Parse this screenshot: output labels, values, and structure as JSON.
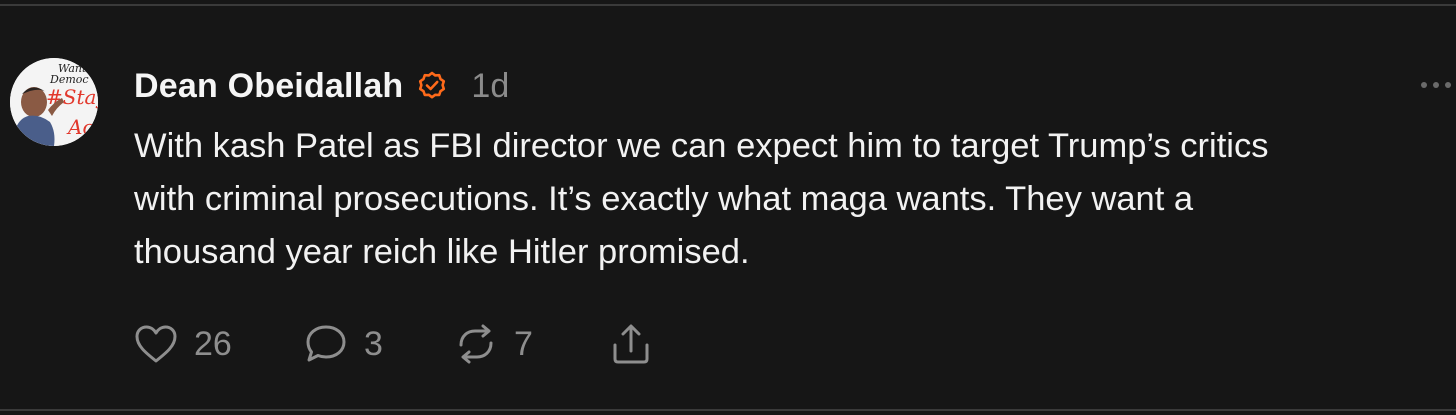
{
  "post": {
    "author": {
      "name": "Dean Obeidallah",
      "avatar_text": [
        "Want",
        "Democ",
        "#Stay",
        "Ac"
      ]
    },
    "verified_icon": "verified-badge-icon",
    "timestamp": "1d",
    "text": "With kash Patel as FBI director we can expect him to target Trump’s critics\nwith criminal prosecutions. It’s exactly what maga wants. They want a\nthousand year reich like Hitler promised.",
    "actions": {
      "like": {
        "icon": "heart-icon",
        "count": "26"
      },
      "reply": {
        "icon": "comment-icon",
        "count": "3"
      },
      "repost": {
        "icon": "repost-icon",
        "count": "7"
      },
      "share": {
        "icon": "share-icon"
      }
    },
    "more_icon": "more-horizontal-icon"
  },
  "colors": {
    "background": "#161616",
    "text": "#f2f2f2",
    "muted": "#8e8e8e",
    "verified": "#ff6a1a",
    "avatar_accent": "#e2382c"
  }
}
